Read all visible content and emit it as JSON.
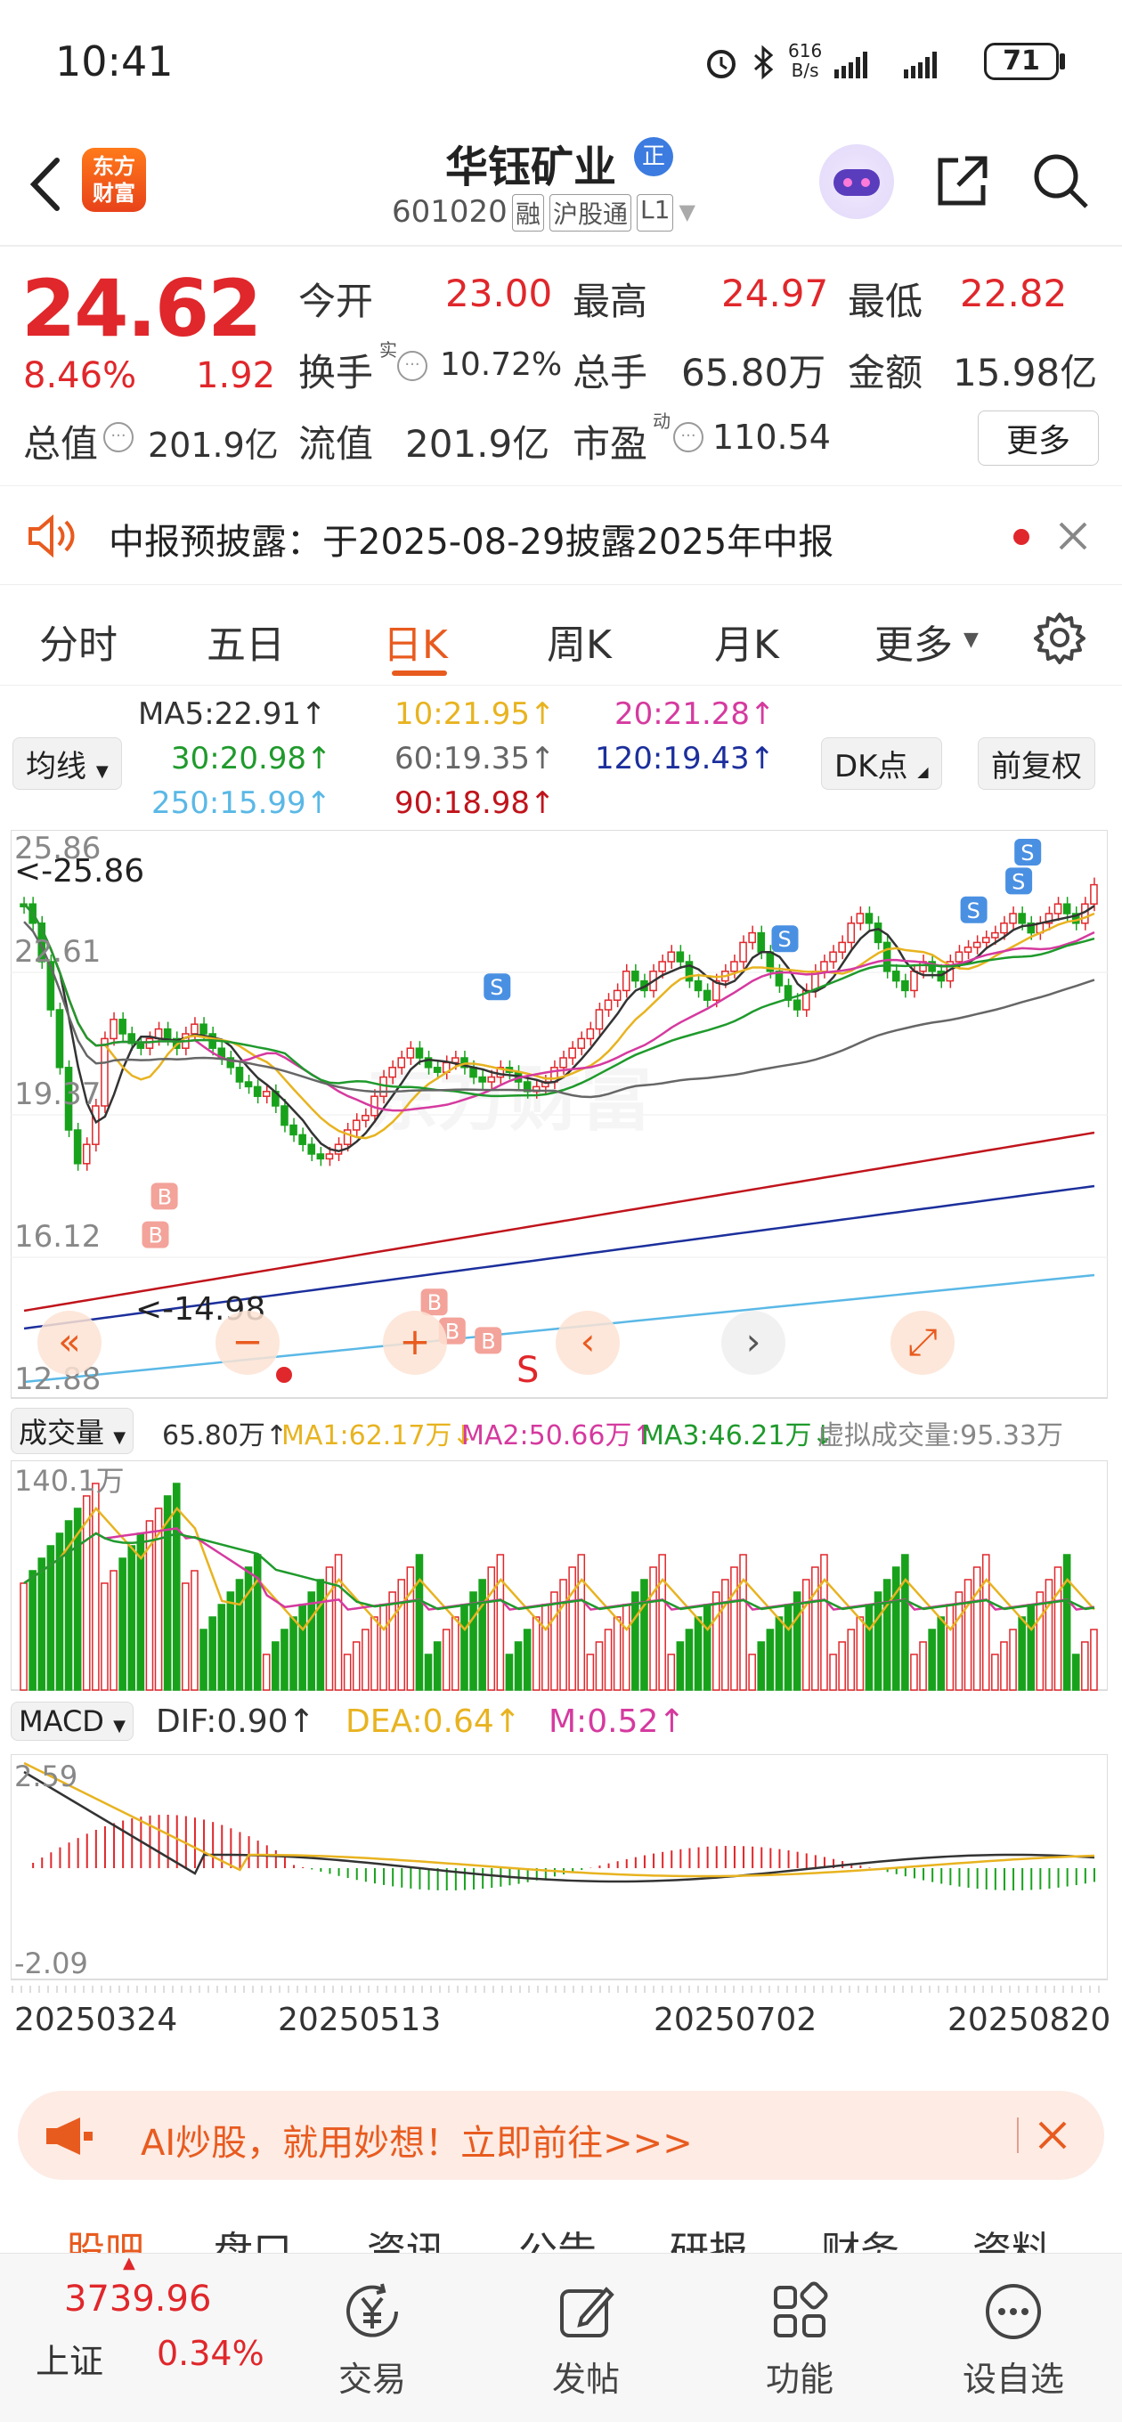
{
  "status": {
    "time": "10:41",
    "net_speed_value": "616",
    "net_speed_unit": "B/s",
    "battery": "71"
  },
  "nav": {
    "logo_line1": "东方",
    "logo_line2": "财富",
    "title": "华钰矿业",
    "title_badge": "正",
    "code": "601020",
    "tags": [
      "融",
      "沪股通",
      "L1"
    ]
  },
  "quote": {
    "price": "24.62",
    "pct": "8.46%",
    "change": "1.92",
    "rows": [
      [
        {
          "label": "今开",
          "value": "23.00",
          "color": "red"
        },
        {
          "label": "最高",
          "value": "24.97",
          "color": "red"
        },
        {
          "label": "最低",
          "value": "22.82",
          "color": "red"
        }
      ],
      [
        {
          "label": "换手",
          "sup": "实",
          "value": "10.72%",
          "color": "dark"
        },
        {
          "label": "总手",
          "value": "65.80万",
          "color": "dark"
        },
        {
          "label": "金额",
          "value": "15.98亿",
          "color": "dark"
        }
      ],
      [
        {
          "label": "总值",
          "value": "201.9亿",
          "color": "dark"
        },
        {
          "label": "流值",
          "value": "201.9亿",
          "color": "dark"
        },
        {
          "label": "市盈",
          "sup": "动",
          "value": "110.54",
          "color": "dark"
        }
      ]
    ],
    "more_button": "更多"
  },
  "notice": {
    "text": "中报预披露：于2025-08-29披露2025年中报"
  },
  "tabs": {
    "items": [
      "分时",
      "五日",
      "日K",
      "周K",
      "月K",
      "更多"
    ],
    "active": "日K"
  },
  "ma_legend": {
    "selector": "均线",
    "dk_button": "DK点",
    "adjust_button": "前复权",
    "items": [
      {
        "text": "MA5:22.91↑",
        "color": "#333333"
      },
      {
        "text": "10:21.95↑",
        "color": "#e8b320"
      },
      {
        "text": "20:21.28↑",
        "color": "#d53a9f"
      },
      {
        "text": "30:20.98↑",
        "color": "#1f9a2c"
      },
      {
        "text": "60:19.35↑",
        "color": "#666666"
      },
      {
        "text": "120:19.43↑",
        "color": "#1c2f9c"
      },
      {
        "text": "250:15.99↑",
        "color": "#5ab8e6"
      },
      {
        "text": "90:18.98↑",
        "color": "#c0141c"
      }
    ]
  },
  "kchart": {
    "y_ticks": [
      "25.86",
      "22.61",
      "19.37",
      "16.12",
      "12.88"
    ],
    "high_label": "<-25.86",
    "low_label": "<-14.98",
    "watermark": "东方财富",
    "buy_marker": "B",
    "sell_marker": "S"
  },
  "vol": {
    "selector": "成交量",
    "items": [
      {
        "text": "65.80万↑",
        "color": "#333333"
      },
      {
        "text": "MA1:62.17万↓",
        "color": "#e8b320"
      },
      {
        "text": "MA2:50.66万↑",
        "color": "#d53a9f"
      },
      {
        "text": "MA3:46.21万↓",
        "color": "#1f9a2c"
      },
      {
        "text": "虚拟成交量:95.33万",
        "color": "#888888"
      }
    ],
    "max_label": "140.1万"
  },
  "macd": {
    "selector": "MACD",
    "items": [
      {
        "text": "DIF:0.90↑",
        "color": "#333333"
      },
      {
        "text": "DEA:0.64↑",
        "color": "#e8b320"
      },
      {
        "text": "M:0.52↑",
        "color": "#d53a9f"
      }
    ],
    "top_label": "2.59",
    "bottom_label": "-2.09"
  },
  "dates": [
    "20250324",
    "20250513",
    "20250702",
    "20250820"
  ],
  "ad": {
    "text": "AI炒股，就用妙想！立即前往>>>"
  },
  "bottom_tabs": [
    "股吧",
    "盘口",
    "资讯",
    "公告",
    "研报",
    "财务",
    "资料"
  ],
  "footer": {
    "index_name": "上证",
    "index_value": "3739.96",
    "index_pct": "0.34%",
    "items": [
      "交易",
      "发帖",
      "功能",
      "设自选"
    ]
  },
  "colors": {
    "up": "#e0272b",
    "down": "#18a21c",
    "accent": "#e85b1f"
  }
}
